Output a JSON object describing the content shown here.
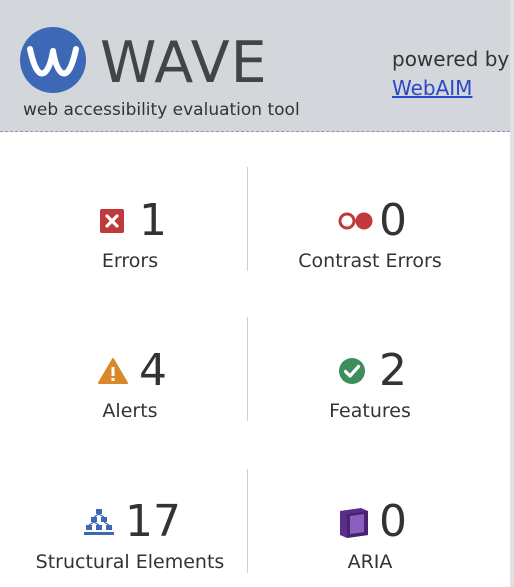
{
  "header": {
    "app_name": "WAVE",
    "tagline": "web accessibility evaluation tool",
    "powered_by": "powered by",
    "link_text": "WebAIM"
  },
  "summary": {
    "errors": {
      "count": "1",
      "label": "Errors",
      "icon": "error-icon",
      "color": "#c0393b"
    },
    "contrast": {
      "count": "0",
      "label": "Contrast Errors",
      "icon": "contrast-icon",
      "color": "#c0393b"
    },
    "alerts": {
      "count": "4",
      "label": "Alerts",
      "icon": "alert-icon",
      "color": "#d9882a"
    },
    "features": {
      "count": "2",
      "label": "Features",
      "icon": "feature-icon",
      "color": "#3d8e5b"
    },
    "structure": {
      "count": "17",
      "label": "Structural Elements",
      "icon": "structure-icon",
      "color": "#3c68b5"
    },
    "aria": {
      "count": "0",
      "label": "ARIA",
      "icon": "aria-icon",
      "color": "#5b2d8a"
    }
  }
}
